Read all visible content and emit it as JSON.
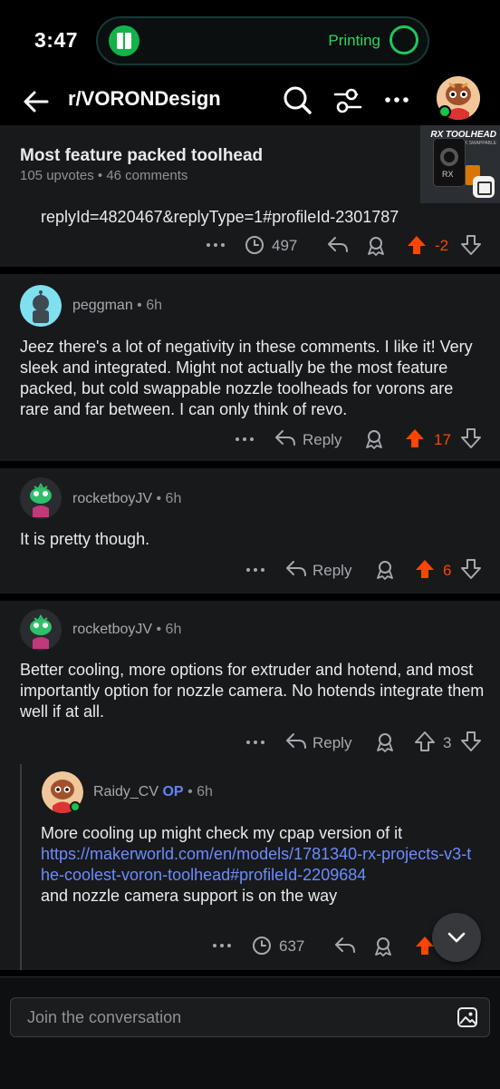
{
  "status_bar": {
    "time": "3:47",
    "activity_label": "Printing",
    "activity_color": "#22c55e"
  },
  "header": {
    "title": "r/VORONDesign",
    "icons": [
      "back-arrow-icon",
      "search-icon",
      "filter-icon",
      "more-icon",
      "avatar"
    ]
  },
  "post": {
    "title": "Most feature packed toolhead",
    "upvotes": "105 upvotes",
    "comments": "46 comments",
    "thumbnail_brand": "RX TOOLHEAD",
    "thumbnail_subtitle": "V QUICK SWAPPABLE",
    "thumbnail_mark": "RX"
  },
  "comments": [
    {
      "id": "fragment",
      "body_link": "replyId=4820467&replyType=1#profileId-2301787",
      "award_count": "497",
      "vote_count": "-2",
      "voted": "up"
    },
    {
      "id": "peggman",
      "username": "peggman",
      "age": "6h",
      "body": "Jeez there's a lot of negativity in these comments. I like it! Very sleek and integrated. Might not actually be the most feature packed, but cold swappable nozzle toolheads for vorons are rare and far between. I can only think of revo.",
      "reply_label": "Reply",
      "vote_count": "17",
      "voted": "up"
    },
    {
      "id": "rocketboy1",
      "username": "rocketboyJV",
      "age": "6h",
      "body": "It is pretty though.",
      "reply_label": "Reply",
      "vote_count": "6",
      "voted": "up"
    },
    {
      "id": "rocketboy2",
      "username": "rocketboyJV",
      "age": "6h",
      "body": "Better cooling, more options for extruder and hotend, and most importantly option for nozzle camera. No hotends integrate them well if at all.",
      "reply_label": "Reply",
      "vote_count": "3",
      "voted": "none"
    },
    {
      "id": "raidy",
      "username": "Raidy_CV",
      "op_badge": "OP",
      "age": "6h",
      "body_before": "More cooling up might check my cpap version of it",
      "body_link": "https://makerworld.com/en/models/1781340-rx-projects-v3-the-coolest-voron-toolhead#profileId-2209684",
      "body_after": "and nozzle camera support is on the way",
      "award_count": "637"
    }
  ],
  "composer": {
    "placeholder": "Join the conversation"
  },
  "colors": {
    "upvote_active": "#ff4500",
    "link": "#6b8cff",
    "op": "#5a85ff"
  }
}
